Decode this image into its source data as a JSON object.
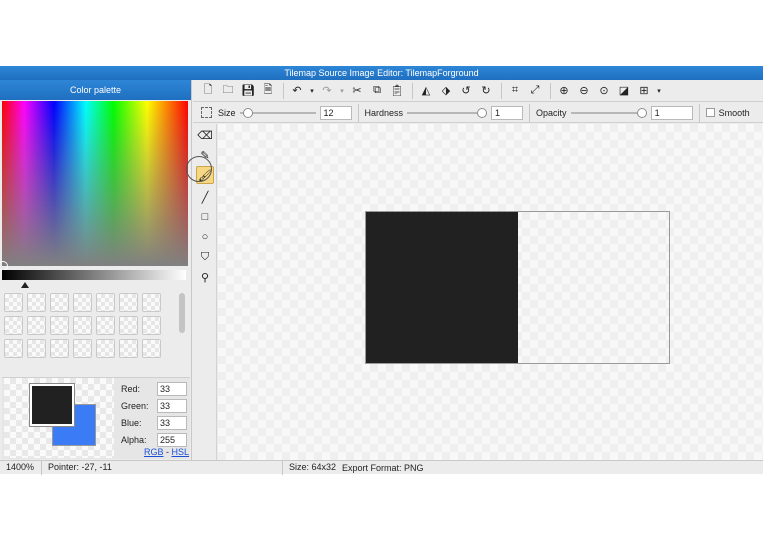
{
  "window": {
    "title": "Tilemap Source Image Editor: TilemapForground"
  },
  "palette": {
    "header": "Color palette",
    "swatch_count": 21,
    "foreground_color": "#212121",
    "background_color": "#3b7cf6",
    "red_label": "Red:",
    "red_value": "33",
    "green_label": "Green:",
    "green_value": "33",
    "blue_label": "Blue:",
    "blue_value": "33",
    "alpha_label": "Alpha:",
    "alpha_value": "255",
    "mode_rgb": "RGB",
    "mode_sep": " - ",
    "mode_hsl": "HSL"
  },
  "toolbar": {
    "icons": [
      "new-file-icon",
      "open-folder-icon",
      "save-icon",
      "save-as-icon",
      "undo-icon",
      "redo-icon",
      "cut-icon",
      "copy-icon",
      "paste-icon",
      "flip-horizontal-icon",
      "flip-vertical-icon",
      "rotate-left-icon",
      "rotate-right-icon",
      "crop-icon",
      "resize-icon",
      "zoom-in-icon",
      "zoom-out-icon",
      "zoom-fit-icon",
      "contrast-icon",
      "grid-icon"
    ]
  },
  "options": {
    "size_label": "Size",
    "size_value": "12",
    "size_level": 0.05,
    "hardness_label": "Hardness",
    "hardness_value": "1",
    "hardness_level": 1.0,
    "opacity_label": "Opacity",
    "opacity_value": "1",
    "opacity_level": 1.0,
    "smooth_label": "Smooth"
  },
  "tools": [
    "eraser-icon",
    "pencil-icon",
    "brush-icon",
    "line-icon",
    "rectangle-icon",
    "ellipse-icon",
    "fill-bucket-icon",
    "eyedropper-icon"
  ],
  "active_tool": "brush-icon",
  "status": {
    "zoom": "1400%",
    "pointer": "Pointer: -27, -11",
    "size": "Size: 64x32",
    "export": "Export Format: PNG"
  }
}
